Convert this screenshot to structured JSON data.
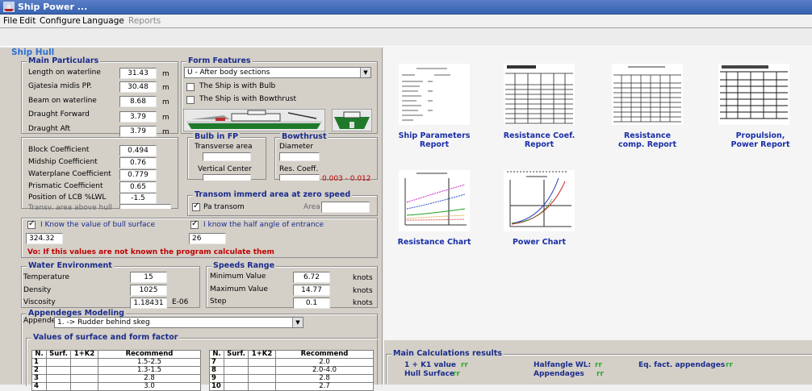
{
  "window": {
    "title": "Ship Power ..."
  },
  "menu": [
    "File",
    "Edit",
    "Configure",
    "Language",
    "Reports"
  ],
  "hull": {
    "title": "Ship Hull",
    "main_particulars": {
      "title": "Main Particulars",
      "rows": [
        {
          "label": "Length on waterline",
          "value": "31.43",
          "unit": "m"
        },
        {
          "label": "Gjatesia midis PP.",
          "value": "30.48",
          "unit": "m"
        },
        {
          "label": "Beam on waterline",
          "value": "8.68",
          "unit": "m"
        },
        {
          "label": "Draught Forward",
          "value": "3.79",
          "unit": "m"
        },
        {
          "label": "Draught Aft",
          "value": "3.79",
          "unit": "m"
        }
      ]
    },
    "form_features": {
      "title": "Form Features",
      "selected": "U - After body sections",
      "bulb_check": "The Ship is with Bulb",
      "bowthrust_check": "The Ship is with Bowthrust"
    },
    "coefficients": [
      {
        "label": "Block Coefficient",
        "value": "0.494"
      },
      {
        "label": "Midship Coefficient",
        "value": "0.76"
      },
      {
        "label": "Waterplane Coefficient",
        "value": "0.779"
      },
      {
        "label": "Prismatic Coefficient",
        "value": "0.65"
      },
      {
        "label": "Position of LCB %LWL",
        "value": "-1.5"
      }
    ],
    "transv_area_label": "Transv. area above hull",
    "bulb_fp": {
      "title": "Bulb in FP",
      "transverse_area": "Transverse area",
      "vertical_center": "Vertical Center"
    },
    "bowthrust": {
      "title": "Bowthrust",
      "diameter": "Diameter",
      "res_coeff": "Res. Coeff.",
      "res_range": "0.003 - 0.012"
    },
    "transom": {
      "title": "Transom immerd area at zero speed",
      "check": "Pa transom",
      "area_label": "Area"
    },
    "bull_check": "I Know the value of bull surface",
    "bull_value": "324.32",
    "half_angle_check": "I know the half angle of entrance",
    "half_angle_value": "26",
    "warning": "Vo: If this values are not known the program calculate them",
    "water": {
      "title": "Water Environment",
      "rows": [
        {
          "label": "Temperature",
          "value": "15",
          "unit": ""
        },
        {
          "label": "Density",
          "value": "1025",
          "unit": ""
        },
        {
          "label": "Viscosity",
          "value": "1.18431",
          "unit": "E-06"
        }
      ]
    },
    "speeds": {
      "title": "Speeds Range",
      "rows": [
        {
          "label": "Minimum Value",
          "value": "6.72",
          "unit": "knots"
        },
        {
          "label": "Maximum Value",
          "value": "14.77",
          "unit": "knots"
        },
        {
          "label": "Step",
          "value": "0.1",
          "unit": "knots"
        }
      ]
    },
    "appendages": {
      "title": "Appendeges Modeling",
      "label": "Appendeg",
      "selected": "1. -> Rudder behind skeg",
      "factor_title": "Values of surface and form factor",
      "headers": [
        "N.",
        "Surf.",
        "1+K2",
        "Recommend"
      ],
      "left_rows": [
        {
          "n": "1",
          "rec": "1.5-2.5"
        },
        {
          "n": "2",
          "rec": "1.3-1.5"
        },
        {
          "n": "3",
          "rec": "2.8"
        },
        {
          "n": "4",
          "rec": "3.0"
        }
      ],
      "right_rows": [
        {
          "n": "7",
          "rec": "2.0"
        },
        {
          "n": "8",
          "rec": "2.0-4.0"
        },
        {
          "n": "9",
          "rec": "2.8"
        },
        {
          "n": "10",
          "rec": "2.7"
        }
      ]
    }
  },
  "reports": {
    "items": [
      {
        "line1": "Ship Parameters",
        "line2": "Report"
      },
      {
        "line1": "Resistance Coef.",
        "line2": "Report"
      },
      {
        "line1": "Resistance",
        "line2": "comp. Report"
      },
      {
        "line1": "Propulsion,",
        "line2": "Power Report"
      },
      {
        "line1": "Resistance Chart",
        "line2": ""
      },
      {
        "line1": "Power Chart",
        "line2": ""
      }
    ]
  },
  "results": {
    "title": "Main Calculations results",
    "k1_label": "1 + K1 value",
    "k1_value": "rr",
    "hull_surface_label": "Hull Surface",
    "hull_surface_value": "rr",
    "halfangle_label": "Halfangle WL:",
    "halfangle_value": "rr",
    "appendages_label": "Appendages",
    "appendages_value": "rr",
    "eqfact_label": "Eq. fact. appendages",
    "eqfact_value": "rr"
  },
  "colors": {
    "accent": "#1b2c8c",
    "link": "#1a2fa8",
    "warning": "#c00000",
    "panel": "#d4d0c8"
  }
}
